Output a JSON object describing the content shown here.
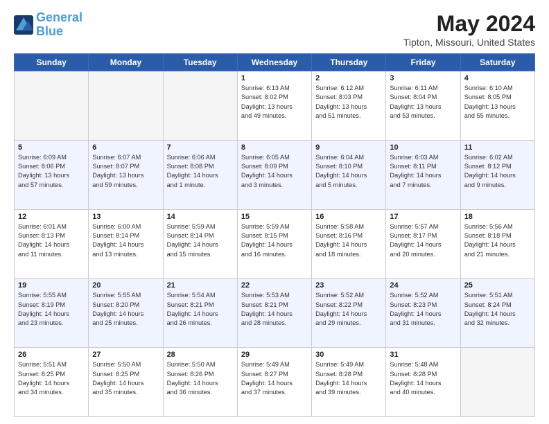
{
  "header": {
    "logo_line1": "General",
    "logo_line2": "Blue",
    "main_title": "May 2024",
    "subtitle": "Tipton, Missouri, United States"
  },
  "days_of_week": [
    "Sunday",
    "Monday",
    "Tuesday",
    "Wednesday",
    "Thursday",
    "Friday",
    "Saturday"
  ],
  "weeks": [
    [
      {
        "day": "",
        "info": ""
      },
      {
        "day": "",
        "info": ""
      },
      {
        "day": "",
        "info": ""
      },
      {
        "day": "1",
        "info": "Sunrise: 6:13 AM\nSunset: 8:02 PM\nDaylight: 13 hours\nand 49 minutes."
      },
      {
        "day": "2",
        "info": "Sunrise: 6:12 AM\nSunset: 8:03 PM\nDaylight: 13 hours\nand 51 minutes."
      },
      {
        "day": "3",
        "info": "Sunrise: 6:11 AM\nSunset: 8:04 PM\nDaylight: 13 hours\nand 53 minutes."
      },
      {
        "day": "4",
        "info": "Sunrise: 6:10 AM\nSunset: 8:05 PM\nDaylight: 13 hours\nand 55 minutes."
      }
    ],
    [
      {
        "day": "5",
        "info": "Sunrise: 6:09 AM\nSunset: 8:06 PM\nDaylight: 13 hours\nand 57 minutes."
      },
      {
        "day": "6",
        "info": "Sunrise: 6:07 AM\nSunset: 8:07 PM\nDaylight: 13 hours\nand 59 minutes."
      },
      {
        "day": "7",
        "info": "Sunrise: 6:06 AM\nSunset: 8:08 PM\nDaylight: 14 hours\nand 1 minute."
      },
      {
        "day": "8",
        "info": "Sunrise: 6:05 AM\nSunset: 8:09 PM\nDaylight: 14 hours\nand 3 minutes."
      },
      {
        "day": "9",
        "info": "Sunrise: 6:04 AM\nSunset: 8:10 PM\nDaylight: 14 hours\nand 5 minutes."
      },
      {
        "day": "10",
        "info": "Sunrise: 6:03 AM\nSunset: 8:11 PM\nDaylight: 14 hours\nand 7 minutes."
      },
      {
        "day": "11",
        "info": "Sunrise: 6:02 AM\nSunset: 8:12 PM\nDaylight: 14 hours\nand 9 minutes."
      }
    ],
    [
      {
        "day": "12",
        "info": "Sunrise: 6:01 AM\nSunset: 8:13 PM\nDaylight: 14 hours\nand 11 minutes."
      },
      {
        "day": "13",
        "info": "Sunrise: 6:00 AM\nSunset: 8:14 PM\nDaylight: 14 hours\nand 13 minutes."
      },
      {
        "day": "14",
        "info": "Sunrise: 5:59 AM\nSunset: 8:14 PM\nDaylight: 14 hours\nand 15 minutes."
      },
      {
        "day": "15",
        "info": "Sunrise: 5:59 AM\nSunset: 8:15 PM\nDaylight: 14 hours\nand 16 minutes."
      },
      {
        "day": "16",
        "info": "Sunrise: 5:58 AM\nSunset: 8:16 PM\nDaylight: 14 hours\nand 18 minutes."
      },
      {
        "day": "17",
        "info": "Sunrise: 5:57 AM\nSunset: 8:17 PM\nDaylight: 14 hours\nand 20 minutes."
      },
      {
        "day": "18",
        "info": "Sunrise: 5:56 AM\nSunset: 8:18 PM\nDaylight: 14 hours\nand 21 minutes."
      }
    ],
    [
      {
        "day": "19",
        "info": "Sunrise: 5:55 AM\nSunset: 8:19 PM\nDaylight: 14 hours\nand 23 minutes."
      },
      {
        "day": "20",
        "info": "Sunrise: 5:55 AM\nSunset: 8:20 PM\nDaylight: 14 hours\nand 25 minutes."
      },
      {
        "day": "21",
        "info": "Sunrise: 5:54 AM\nSunset: 8:21 PM\nDaylight: 14 hours\nand 26 minutes."
      },
      {
        "day": "22",
        "info": "Sunrise: 5:53 AM\nSunset: 8:21 PM\nDaylight: 14 hours\nand 28 minutes."
      },
      {
        "day": "23",
        "info": "Sunrise: 5:52 AM\nSunset: 8:22 PM\nDaylight: 14 hours\nand 29 minutes."
      },
      {
        "day": "24",
        "info": "Sunrise: 5:52 AM\nSunset: 8:23 PM\nDaylight: 14 hours\nand 31 minutes."
      },
      {
        "day": "25",
        "info": "Sunrise: 5:51 AM\nSunset: 8:24 PM\nDaylight: 14 hours\nand 32 minutes."
      }
    ],
    [
      {
        "day": "26",
        "info": "Sunrise: 5:51 AM\nSunset: 8:25 PM\nDaylight: 14 hours\nand 34 minutes."
      },
      {
        "day": "27",
        "info": "Sunrise: 5:50 AM\nSunset: 8:25 PM\nDaylight: 14 hours\nand 35 minutes."
      },
      {
        "day": "28",
        "info": "Sunrise: 5:50 AM\nSunset: 8:26 PM\nDaylight: 14 hours\nand 36 minutes."
      },
      {
        "day": "29",
        "info": "Sunrise: 5:49 AM\nSunset: 8:27 PM\nDaylight: 14 hours\nand 37 minutes."
      },
      {
        "day": "30",
        "info": "Sunrise: 5:49 AM\nSunset: 8:28 PM\nDaylight: 14 hours\nand 39 minutes."
      },
      {
        "day": "31",
        "info": "Sunrise: 5:48 AM\nSunset: 8:28 PM\nDaylight: 14 hours\nand 40 minutes."
      },
      {
        "day": "",
        "info": ""
      }
    ]
  ]
}
